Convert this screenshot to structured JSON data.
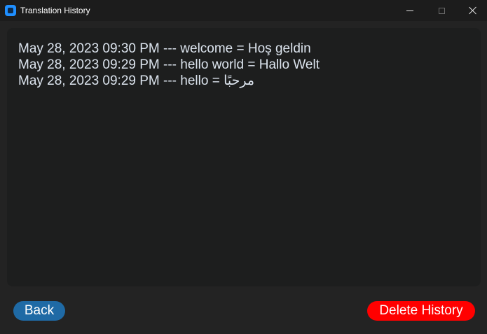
{
  "window": {
    "title": "Translation History",
    "icon": "app-icon",
    "controls": {
      "minimize": "minimize-icon",
      "maximize": "maximize-icon",
      "close": "close-icon"
    }
  },
  "history": {
    "entries": [
      "May 28, 2023 09:30 PM --- welcome = Hoş geldin",
      "May 28, 2023 09:29 PM --- hello world = Hallo Welt",
      "May 28, 2023 09:29 PM --- hello = مرحبًا"
    ]
  },
  "buttons": {
    "back_label": "Back",
    "delete_label": "Delete History"
  },
  "colors": {
    "back_button": "#1f6aa5",
    "delete_button": "#ff0000",
    "text": "#dce4ee",
    "panel": "#1d1e1e",
    "background": "#232323"
  }
}
